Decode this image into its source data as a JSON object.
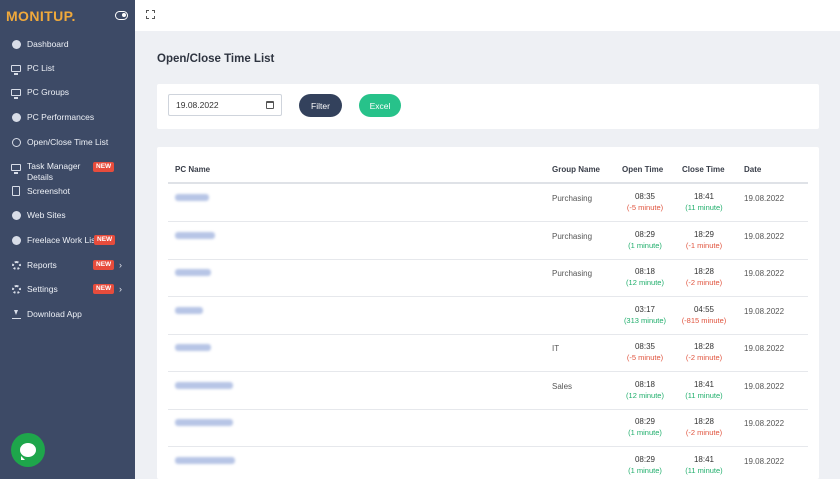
{
  "brand": "MONITUP.",
  "sidebar": {
    "items": [
      {
        "label": "Dashboard",
        "icon": "dashboard-icon"
      },
      {
        "label": "PC List",
        "icon": "monitor-icon"
      },
      {
        "label": "PC Groups",
        "icon": "monitor-icon"
      },
      {
        "label": "PC Performances",
        "icon": "gauge-icon"
      },
      {
        "label": "Open/Close Time List",
        "icon": "clock-icon"
      },
      {
        "label": "Task Manager Details",
        "icon": "monitor-icon",
        "badge": "NEW"
      },
      {
        "label": "Screenshot",
        "icon": "document-icon"
      },
      {
        "label": "Web Sites",
        "icon": "globe-icon"
      },
      {
        "label": "Freelace Work List",
        "icon": "globe-icon",
        "badge": "NEW"
      },
      {
        "label": "Reports",
        "icon": "gear-icon",
        "badge": "NEW",
        "chevron": "›"
      },
      {
        "label": "Settings",
        "icon": "gear-icon",
        "badge": "NEW",
        "chevron": "›"
      },
      {
        "label": "Download App",
        "icon": "download-icon"
      }
    ]
  },
  "page": {
    "title": "Open/Close Time List"
  },
  "filter": {
    "date_value": "19.08.2022",
    "filter_label": "Filter",
    "excel_label": "Excel"
  },
  "table": {
    "headers": {
      "pc_name": "PC Name",
      "group": "Group Name",
      "open": "Open Time",
      "close": "Close Time",
      "date": "Date"
    },
    "rows": [
      {
        "group": "Purchasing",
        "open": "08:35",
        "open_diff": "(-5 minute)",
        "close": "18:41",
        "close_diff": "(11 minute)",
        "date": "19.08.2022"
      },
      {
        "group": "Purchasing",
        "open": "08:29",
        "open_diff": "(1 minute)",
        "close": "18:29",
        "close_diff": "(-1 minute)",
        "date": "19.08.2022"
      },
      {
        "group": "Purchasing",
        "open": "08:18",
        "open_diff": "(12 minute)",
        "close": "18:28",
        "close_diff": "(-2 minute)",
        "date": "19.08.2022"
      },
      {
        "group": "",
        "open": "03:17",
        "open_diff": "(313 minute)",
        "close": "04:55",
        "close_diff": "(-815 minute)",
        "date": "19.08.2022"
      },
      {
        "group": "IT",
        "open": "08:35",
        "open_diff": "(-5 minute)",
        "close": "18:28",
        "close_diff": "(-2 minute)",
        "date": "19.08.2022"
      },
      {
        "group": "Sales",
        "open": "08:18",
        "open_diff": "(12 minute)",
        "close": "18:41",
        "close_diff": "(11 minute)",
        "date": "19.08.2022"
      },
      {
        "group": "",
        "open": "08:29",
        "open_diff": "(1 minute)",
        "close": "18:28",
        "close_diff": "(-2 minute)",
        "date": "19.08.2022"
      },
      {
        "group": "",
        "open": "08:29",
        "open_diff": "(1 minute)",
        "close": "18:41",
        "close_diff": "(11 minute)",
        "date": "19.08.2022"
      }
    ]
  },
  "colors": {
    "sidebar": "#3d4a66",
    "brand": "#f0a93b",
    "filter_btn": "#33415c",
    "excel_btn": "#27c28a",
    "negative": "#e0533d",
    "positive": "#1fae6b",
    "badge": "#e74c3c"
  }
}
